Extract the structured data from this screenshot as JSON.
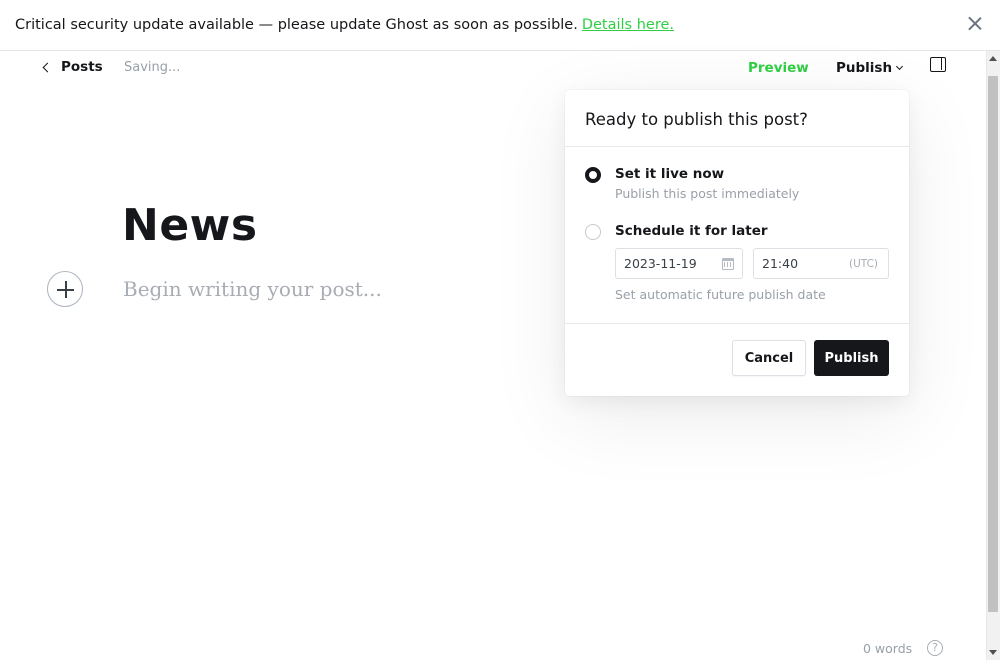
{
  "alert": {
    "message": "Critical security update available — please update Ghost as soon as possible.",
    "link_text": "Details here."
  },
  "header": {
    "back_label": "Posts",
    "status": "Saving...",
    "preview_label": "Preview",
    "publish_label": "Publish"
  },
  "editor": {
    "title": "News",
    "body_placeholder": "Begin writing your post..."
  },
  "footer": {
    "word_count": "0 words",
    "help": "?"
  },
  "publish_menu": {
    "heading": "Ready to publish this post?",
    "options": [
      {
        "label": "Set it live now",
        "description": "Publish this post immediately",
        "selected": true
      },
      {
        "label": "Schedule it for later",
        "description": "Set automatic future publish date",
        "selected": false
      }
    ],
    "schedule": {
      "date": "2023-11-19",
      "time": "21:40",
      "timezone": "(UTC)"
    },
    "cancel_label": "Cancel",
    "publish_label": "Publish"
  },
  "colors": {
    "accent_green": "#30cf43",
    "dark": "#15171a",
    "muted": "#99a0a8"
  }
}
